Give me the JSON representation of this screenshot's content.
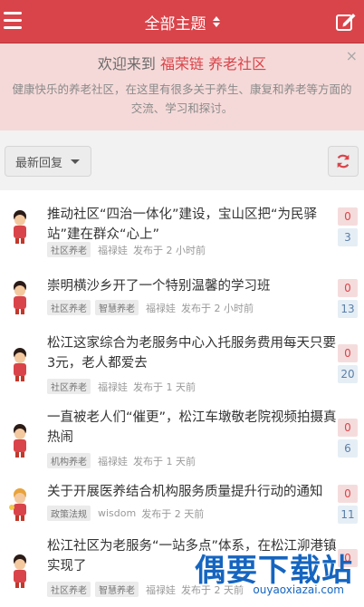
{
  "header": {
    "title": "全部主题",
    "background": "#d9444a"
  },
  "welcome": {
    "heading_prefix": "欢迎来到",
    "heading_brand": "福荣链 养老社区",
    "description": "健康快乐的养老社区，在这里有很多关于养生、康复和养老等方面的交流、学习和探讨。",
    "close_label": "×"
  },
  "filter": {
    "sort_label": "最新回复"
  },
  "topics": [
    {
      "title": "推动社区“四治一体化”建设，宝山区把“为民驿站”建在群众“心上”",
      "tags": [
        "社区养老"
      ],
      "author": "福禄娃",
      "posted": "发布于 2 小时前",
      "count_top": "0",
      "count_bottom": "3"
    },
    {
      "title": "崇明横沙乡开了一个特别温馨的学习班",
      "tags": [
        "社区养老",
        "智慧养老"
      ],
      "author": "福禄娃",
      "posted": "发布于 2 小时前",
      "count_top": "0",
      "count_bottom": "13"
    },
    {
      "title": "松江这家综合为老服务中心入托服务费用每天只要3元，老人都爱去",
      "tags": [
        "社区养老"
      ],
      "author": "福禄娃",
      "posted": "发布于 1 天前",
      "count_top": "0",
      "count_bottom": "20"
    },
    {
      "title": "一直被老人们“催更”，松江车墩敬老院视频拍摄真热闹",
      "tags": [
        "机构养老"
      ],
      "author": "福禄娃",
      "posted": "发布于 1 天前",
      "count_top": "0",
      "count_bottom": "6"
    },
    {
      "title": "关于开展医养结合机构服务质量提升行动的通知",
      "tags": [
        "政策法规"
      ],
      "author": "wisdom",
      "posted": "发布于 2 天前",
      "count_top": "0",
      "count_bottom": "11"
    },
    {
      "title": "松江社区为老服务“一站多点”体系，在松江泖港镇实现了",
      "tags": [
        "社区养老",
        "智慧养老"
      ],
      "author": "福禄娃",
      "posted": "发布于 2 天前",
      "count_top": "0",
      "count_bottom": ""
    }
  ],
  "watermark": {
    "main": "偶要下载站",
    "sub": "ouyaoxiazai.com"
  }
}
